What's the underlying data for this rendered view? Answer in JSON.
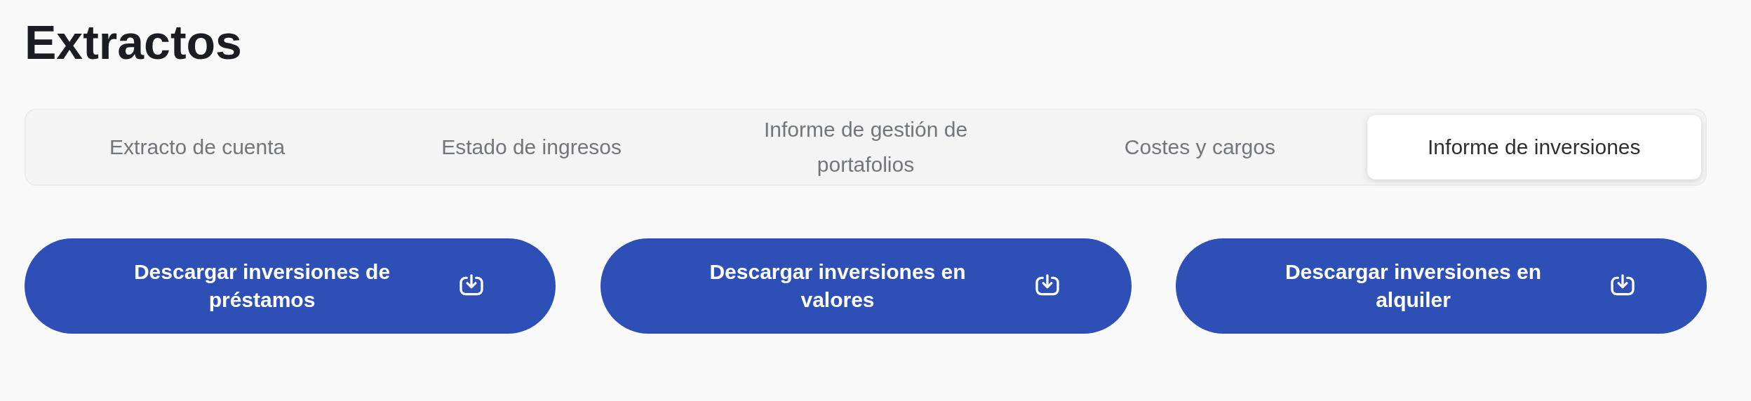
{
  "title": "Extractos",
  "tabs": [
    {
      "label": "Extracto de cuenta",
      "selected": false
    },
    {
      "label": "Estado de ingresos",
      "selected": false
    },
    {
      "label": "Informe de gestión de portafolios",
      "selected": false
    },
    {
      "label": "Costes y cargos",
      "selected": false
    },
    {
      "label": "Informe de inversiones",
      "selected": true
    }
  ],
  "buttons": [
    {
      "label": "Descargar inversiones de préstamos"
    },
    {
      "label": "Descargar inversiones en valores"
    },
    {
      "label": "Descargar inversiones en alquiler"
    }
  ]
}
